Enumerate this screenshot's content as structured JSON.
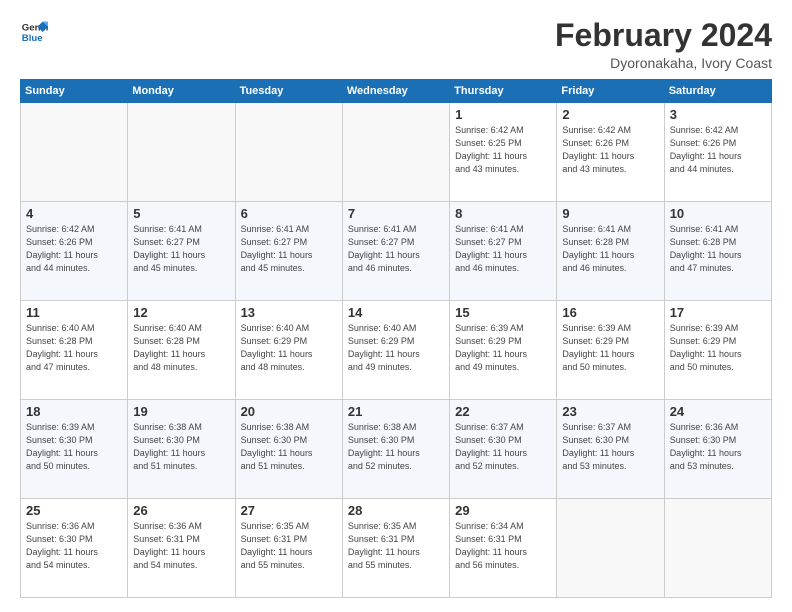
{
  "header": {
    "logo_general": "General",
    "logo_blue": "Blue",
    "title": "February 2024",
    "subtitle": "Dyoronakaha, Ivory Coast"
  },
  "days_of_week": [
    "Sunday",
    "Monday",
    "Tuesday",
    "Wednesday",
    "Thursday",
    "Friday",
    "Saturday"
  ],
  "weeks": [
    [
      {
        "day": "",
        "info": ""
      },
      {
        "day": "",
        "info": ""
      },
      {
        "day": "",
        "info": ""
      },
      {
        "day": "",
        "info": ""
      },
      {
        "day": "1",
        "info": "Sunrise: 6:42 AM\nSunset: 6:25 PM\nDaylight: 11 hours\nand 43 minutes."
      },
      {
        "day": "2",
        "info": "Sunrise: 6:42 AM\nSunset: 6:26 PM\nDaylight: 11 hours\nand 43 minutes."
      },
      {
        "day": "3",
        "info": "Sunrise: 6:42 AM\nSunset: 6:26 PM\nDaylight: 11 hours\nand 44 minutes."
      }
    ],
    [
      {
        "day": "4",
        "info": "Sunrise: 6:42 AM\nSunset: 6:26 PM\nDaylight: 11 hours\nand 44 minutes."
      },
      {
        "day": "5",
        "info": "Sunrise: 6:41 AM\nSunset: 6:27 PM\nDaylight: 11 hours\nand 45 minutes."
      },
      {
        "day": "6",
        "info": "Sunrise: 6:41 AM\nSunset: 6:27 PM\nDaylight: 11 hours\nand 45 minutes."
      },
      {
        "day": "7",
        "info": "Sunrise: 6:41 AM\nSunset: 6:27 PM\nDaylight: 11 hours\nand 46 minutes."
      },
      {
        "day": "8",
        "info": "Sunrise: 6:41 AM\nSunset: 6:27 PM\nDaylight: 11 hours\nand 46 minutes."
      },
      {
        "day": "9",
        "info": "Sunrise: 6:41 AM\nSunset: 6:28 PM\nDaylight: 11 hours\nand 46 minutes."
      },
      {
        "day": "10",
        "info": "Sunrise: 6:41 AM\nSunset: 6:28 PM\nDaylight: 11 hours\nand 47 minutes."
      }
    ],
    [
      {
        "day": "11",
        "info": "Sunrise: 6:40 AM\nSunset: 6:28 PM\nDaylight: 11 hours\nand 47 minutes."
      },
      {
        "day": "12",
        "info": "Sunrise: 6:40 AM\nSunset: 6:28 PM\nDaylight: 11 hours\nand 48 minutes."
      },
      {
        "day": "13",
        "info": "Sunrise: 6:40 AM\nSunset: 6:29 PM\nDaylight: 11 hours\nand 48 minutes."
      },
      {
        "day": "14",
        "info": "Sunrise: 6:40 AM\nSunset: 6:29 PM\nDaylight: 11 hours\nand 49 minutes."
      },
      {
        "day": "15",
        "info": "Sunrise: 6:39 AM\nSunset: 6:29 PM\nDaylight: 11 hours\nand 49 minutes."
      },
      {
        "day": "16",
        "info": "Sunrise: 6:39 AM\nSunset: 6:29 PM\nDaylight: 11 hours\nand 50 minutes."
      },
      {
        "day": "17",
        "info": "Sunrise: 6:39 AM\nSunset: 6:29 PM\nDaylight: 11 hours\nand 50 minutes."
      }
    ],
    [
      {
        "day": "18",
        "info": "Sunrise: 6:39 AM\nSunset: 6:30 PM\nDaylight: 11 hours\nand 50 minutes."
      },
      {
        "day": "19",
        "info": "Sunrise: 6:38 AM\nSunset: 6:30 PM\nDaylight: 11 hours\nand 51 minutes."
      },
      {
        "day": "20",
        "info": "Sunrise: 6:38 AM\nSunset: 6:30 PM\nDaylight: 11 hours\nand 51 minutes."
      },
      {
        "day": "21",
        "info": "Sunrise: 6:38 AM\nSunset: 6:30 PM\nDaylight: 11 hours\nand 52 minutes."
      },
      {
        "day": "22",
        "info": "Sunrise: 6:37 AM\nSunset: 6:30 PM\nDaylight: 11 hours\nand 52 minutes."
      },
      {
        "day": "23",
        "info": "Sunrise: 6:37 AM\nSunset: 6:30 PM\nDaylight: 11 hours\nand 53 minutes."
      },
      {
        "day": "24",
        "info": "Sunrise: 6:36 AM\nSunset: 6:30 PM\nDaylight: 11 hours\nand 53 minutes."
      }
    ],
    [
      {
        "day": "25",
        "info": "Sunrise: 6:36 AM\nSunset: 6:30 PM\nDaylight: 11 hours\nand 54 minutes."
      },
      {
        "day": "26",
        "info": "Sunrise: 6:36 AM\nSunset: 6:31 PM\nDaylight: 11 hours\nand 54 minutes."
      },
      {
        "day": "27",
        "info": "Sunrise: 6:35 AM\nSunset: 6:31 PM\nDaylight: 11 hours\nand 55 minutes."
      },
      {
        "day": "28",
        "info": "Sunrise: 6:35 AM\nSunset: 6:31 PM\nDaylight: 11 hours\nand 55 minutes."
      },
      {
        "day": "29",
        "info": "Sunrise: 6:34 AM\nSunset: 6:31 PM\nDaylight: 11 hours\nand 56 minutes."
      },
      {
        "day": "",
        "info": ""
      },
      {
        "day": "",
        "info": ""
      }
    ]
  ]
}
